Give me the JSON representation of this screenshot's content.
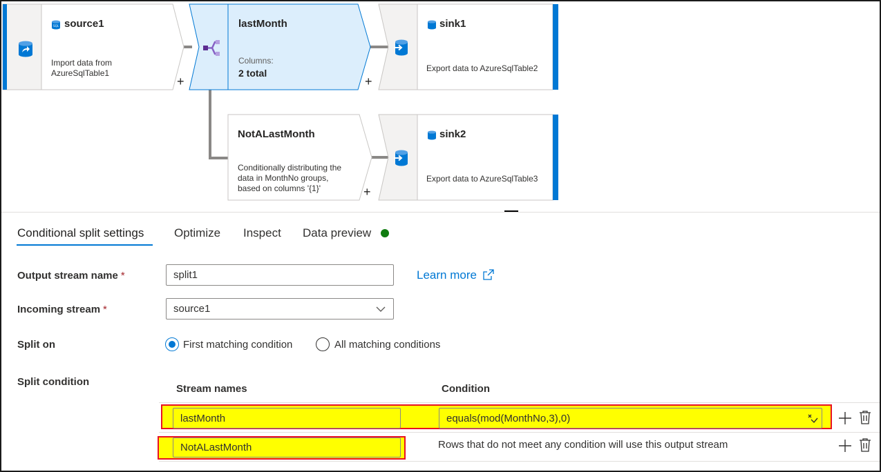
{
  "graph": {
    "source1": {
      "title": "source1",
      "description": "Import data from AzureSqlTable1",
      "desc_line1": "Import data from",
      "desc_line2": "AzureSqlTable1"
    },
    "lastMonth": {
      "title": "lastMonth",
      "columns_label": "Columns:",
      "columns_value": "2 total"
    },
    "sink1": {
      "title": "sink1",
      "description": "Export data to AzureSqlTable2"
    },
    "NotALastMonth": {
      "title": "NotALastMonth",
      "desc_line1": "Conditionally distributing the",
      "desc_line2": "data in MonthNo groups,",
      "desc_line3": "based on columns '{1}'"
    },
    "sink2": {
      "title": "sink2",
      "description": "Export data to AzureSqlTable3"
    },
    "plus_symbol": "+"
  },
  "tabs": [
    {
      "label": "Conditional split settings",
      "active": true
    },
    {
      "label": "Optimize",
      "active": false
    },
    {
      "label": "Inspect",
      "active": false
    },
    {
      "label": "Data preview",
      "active": false,
      "status_color": "#107c10"
    }
  ],
  "form": {
    "output_stream": {
      "label": "Output stream name",
      "required_mark": "*",
      "value": "split1"
    },
    "learn_more": "Learn more",
    "incoming_stream": {
      "label": "Incoming stream",
      "required_mark": "*",
      "value": "source1"
    },
    "split_on": {
      "label": "Split on",
      "options": [
        {
          "label": "First matching condition",
          "selected": true
        },
        {
          "label": "All matching conditions",
          "selected": false
        }
      ]
    },
    "split_condition": {
      "label": "Split condition",
      "col_stream": "Stream names",
      "col_condition": "Condition",
      "rows": [
        {
          "stream": "lastMonth",
          "condition": "equals(mod(MonthNo,3),0)"
        },
        {
          "stream": "NotALastMonth",
          "condition_note": "Rows that do not meet any condition will use this output stream"
        }
      ]
    }
  },
  "colors": {
    "accent": "#0078d4",
    "highlight": "#ffff00",
    "annotation_border": "#e81123",
    "selected_node_fill": "#dceefc"
  }
}
